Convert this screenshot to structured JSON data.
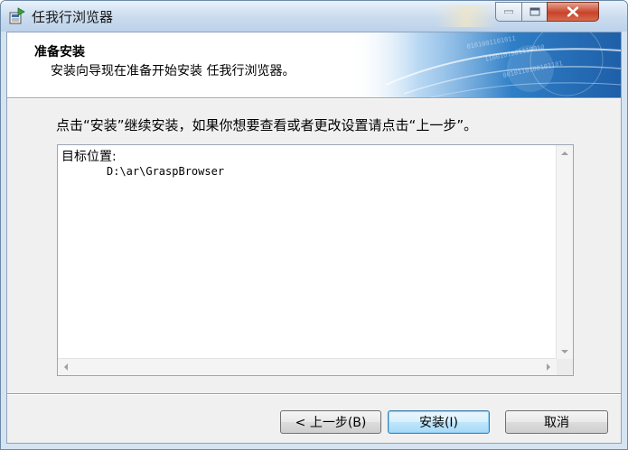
{
  "window": {
    "title": "任我行浏览器"
  },
  "header": {
    "title": "准备安装",
    "subtitle": "安装向导现在准备开始安装 任我行浏览器。"
  },
  "body": {
    "instruction": "点击“安装”继续安装，如果你想要查看或者更改设置请点击“上一步”。",
    "memo": {
      "label": "目标位置:",
      "path": "D:\\ar\\GraspBrowser"
    }
  },
  "buttons": {
    "back": "< 上一步(B)",
    "install": "安装(I)",
    "cancel": "取消"
  },
  "colors": {
    "header_art": "#3a86c8",
    "close_button": "#c8432b",
    "default_button_border": "#3c7fb1"
  },
  "icons": {
    "app": "installer-app-icon",
    "minimize": "minimize-icon",
    "maximize": "maximize-icon",
    "close": "close-icon"
  }
}
